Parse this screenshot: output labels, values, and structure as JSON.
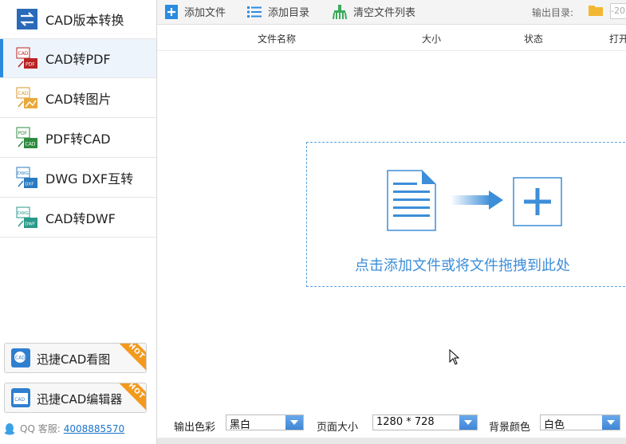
{
  "sidebar": {
    "items": [
      {
        "label": "CAD版本转换",
        "icon": "cad-version-convert-icon"
      },
      {
        "label": "CAD转PDF",
        "icon": "cad-to-pdf-icon"
      },
      {
        "label": "CAD转图片",
        "icon": "cad-to-image-icon"
      },
      {
        "label": "PDF转CAD",
        "icon": "pdf-to-cad-icon"
      },
      {
        "label": "DWG DXF互转",
        "icon": "dwg-dxf-convert-icon"
      },
      {
        "label": "CAD转DWF",
        "icon": "cad-to-dwf-icon"
      }
    ],
    "icon_text": {
      "cad": "CAD",
      "pdf": "PDF",
      "dwg": "DWG",
      "dxf": "DXF",
      "dwf": "DWF"
    },
    "promos": [
      {
        "label": "迅捷CAD看图",
        "badge": "HOT",
        "icon_text": "CAD"
      },
      {
        "label": "迅捷CAD编辑器",
        "badge": "HOT",
        "icon_text": "CAD"
      }
    ],
    "support": {
      "label": "QQ 客服:",
      "number": "4008885570"
    }
  },
  "toolbar": {
    "add_file": "添加文件",
    "add_dir": "添加目录",
    "clear_list": "清空文件列表",
    "output_dir_label": "输出目录:",
    "output_dir_value": "-20"
  },
  "table": {
    "headers": [
      "文件名称",
      "大小",
      "状态",
      "打开"
    ]
  },
  "dropzone": {
    "text": "点击添加文件或将文件拖拽到此处"
  },
  "options": {
    "color_label": "输出色彩",
    "color_value": "黑白",
    "page_size_label": "页面大小",
    "page_size_value": "1280 * 728",
    "bg_color_label": "背景颜色",
    "bg_color_value": "白色"
  },
  "colors": {
    "accent": "#2a8be0",
    "drop_text": "#3d8ed8",
    "hot_badge": "#f39a1e"
  }
}
